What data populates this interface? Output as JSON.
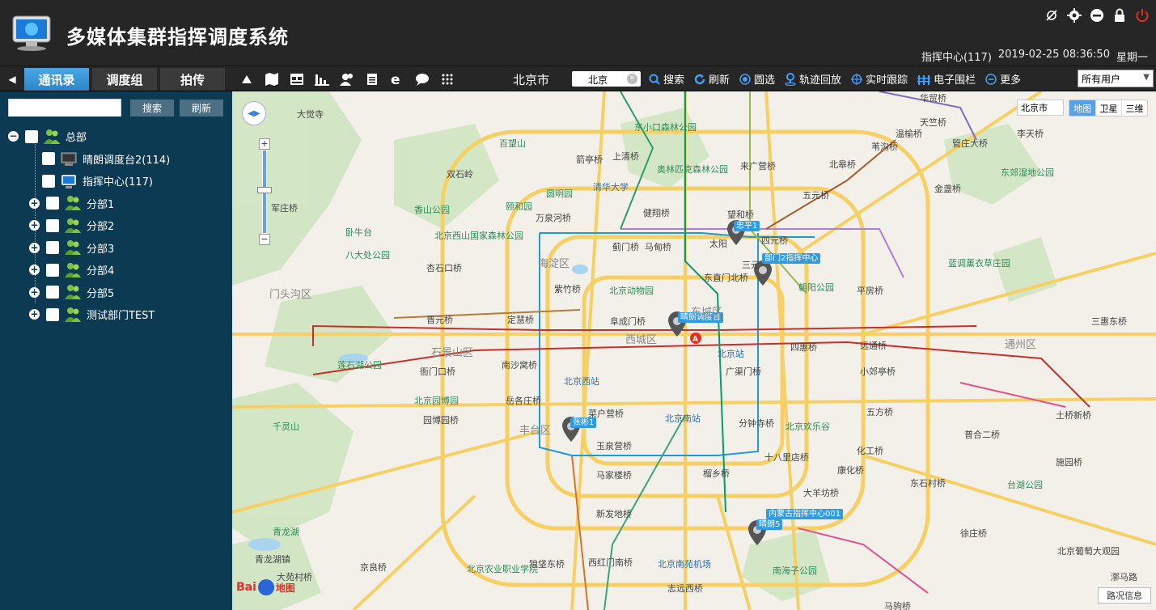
{
  "app": {
    "title": "多媒体集群指挥调度系统",
    "status": {
      "center": "指挥中心(117)",
      "datetime": "2019-02-25 08:36:50",
      "weekday": "星期一"
    },
    "header_icons": [
      "hide-icon",
      "settings-icon",
      "minimize-icon",
      "lock-icon",
      "power-icon"
    ]
  },
  "tabs": [
    {
      "label": "通讯录",
      "active": true
    },
    {
      "label": "调度组",
      "active": false
    },
    {
      "label": "拍传",
      "active": false
    }
  ],
  "toolbar": {
    "city": "北京市",
    "search_value": "北京",
    "actions": [
      {
        "label": "搜索",
        "icon": "search-icon"
      },
      {
        "label": "刷新",
        "icon": "refresh-icon"
      },
      {
        "label": "圆选",
        "icon": "circle-select-icon"
      },
      {
        "label": "轨迹回放",
        "icon": "track-playback-icon"
      },
      {
        "label": "实时跟踪",
        "icon": "tracking-icon"
      },
      {
        "label": "电子围栏",
        "icon": "fence-icon"
      },
      {
        "label": "更多",
        "icon": "more-icon"
      }
    ],
    "user_filter": "所有用户"
  },
  "sidebar": {
    "search_button": "搜索",
    "refresh_button": "刷新",
    "tree": [
      {
        "label": "总部",
        "level": 0,
        "toggle": "−",
        "icon": "group-icon"
      },
      {
        "label": "晴朗调度台2(114)",
        "level": 1,
        "toggle": "",
        "icon": "console-icon"
      },
      {
        "label": "指挥中心(117)",
        "level": 1,
        "toggle": "",
        "icon": "monitor-icon"
      },
      {
        "label": "分部1",
        "level": 1,
        "toggle": "+",
        "icon": "group-icon"
      },
      {
        "label": "分部2",
        "level": 1,
        "toggle": "+",
        "icon": "group-icon"
      },
      {
        "label": "分部3",
        "level": 1,
        "toggle": "+",
        "icon": "group-icon"
      },
      {
        "label": "分部4",
        "level": 1,
        "toggle": "+",
        "icon": "group-icon"
      },
      {
        "label": "分部5",
        "level": 1,
        "toggle": "+",
        "icon": "group-icon"
      },
      {
        "label": "测试部门TEST",
        "level": 1,
        "toggle": "+",
        "icon": "group-icon"
      }
    ]
  },
  "map": {
    "city_select": "北京市",
    "types": [
      {
        "label": "地图",
        "active": true
      },
      {
        "label": "卫星",
        "active": false
      },
      {
        "label": "三维",
        "active": false
      }
    ],
    "traffic_button": "路况信息",
    "markers": [
      "忠平1",
      "部门2指挥中心",
      "晴朗调度台",
      "张彬1",
      "内蒙古指挥中心001",
      "晴朗5"
    ],
    "labels": {
      "l1": "大觉寺",
      "l2": "东小口森林公园",
      "l3": "华贸桥",
      "l4": "天竺桥",
      "l5": "温榆桥",
      "l6": "李天桥",
      "l7": "苇沟桥",
      "l8": "管庄大桥",
      "l9": "百望山",
      "l10": "箭亭桥",
      "l11": "上清桥",
      "l12": "奥林匹克森林公园",
      "l13": "来广营桥",
      "l14": "北皋桥",
      "l15": "东郊湿地公园",
      "l16": "双石岭",
      "l17": "清华大学",
      "l18": "颐和园",
      "l19": "圆明园",
      "l20": "金盏桥",
      "l21": "五元桥",
      "l22": "香山公园",
      "l23": "万泉河桥",
      "l24": "健翔桥",
      "l25": "望和桥",
      "l26": "军庄桥",
      "l27": "北京西山国家森林公园",
      "l28": "卧牛台",
      "l29": "四元桥",
      "l30": "蓝调薰衣草庄园",
      "l31": "蓟门桥",
      "l32": "马甸桥",
      "l33": "太阳",
      "l34": "八大处公园",
      "l35": "杏石口桥",
      "l36": "海淀区",
      "l37": "三元",
      "l38": "东直门北桥",
      "l39": "朝阳公园",
      "l40": "紫竹桥",
      "l41": "北京动物园",
      "l42": "平房桥",
      "l43": "门头沟区",
      "l44": "阜成门桥",
      "l45": "东城区",
      "l46": "三惠东桥",
      "l47": "晋元桥",
      "l48": "定慧桥",
      "l49": "西城区",
      "l50": "石景山区",
      "l51": "北京站",
      "l52": "四惠桥",
      "l53": "远通桥",
      "l54": "通州区",
      "l55": "莲石湖公园",
      "l56": "衙门口桥",
      "l57": "南沙窝桥",
      "l58": "广渠门桥",
      "l59": "小郊亭桥",
      "l60": "北京西站",
      "l61": "北京园博园",
      "l62": "岳各庄桥",
      "l63": "菜户营桥",
      "l64": "北京南站",
      "l65": "分钟寺桥",
      "l66": "五方桥",
      "l67": "千灵山",
      "l68": "园博园桥",
      "l69": "丰台区",
      "l70": "北京欢乐谷",
      "l71": "土桥新桥",
      "l72": "玉泉营桥",
      "l73": "普合二桥",
      "l74": "十八里店桥",
      "l75": "化工桥",
      "l76": "施园桥",
      "l77": "马家楼桥",
      "l78": "榴乡桥",
      "l79": "康化桥",
      "l80": "东石村桥",
      "l81": "台湖公园",
      "l82": "新发地桥",
      "l83": "大羊坊桥",
      "l84": "徐庄桥",
      "l85": "青龙湖",
      "l86": "京良桥",
      "l87": "狼垡东桥",
      "l88": "西红门南桥",
      "l89": "北京南苑机场",
      "l90": "北京农业职业学院",
      "l91": "南海子公园",
      "l92": "大苑村桥",
      "l93": "志远西桥",
      "l94": "北京葡萄大观园",
      "l95": "漷马路",
      "l96": "青龙湖镇",
      "l97": "马驹桥"
    }
  }
}
